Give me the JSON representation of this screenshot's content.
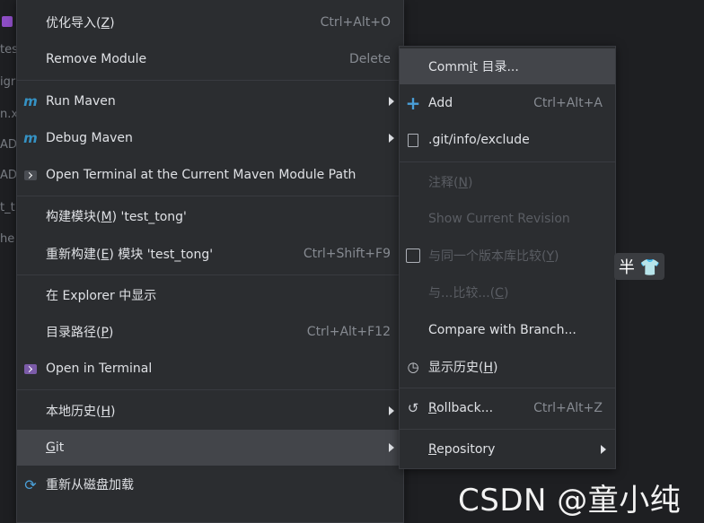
{
  "background": {
    "left_fragments": [
      "tes",
      "igr",
      "n.x",
      "ADI",
      "ADI",
      "t_t",
      "he"
    ]
  },
  "main_menu": {
    "items": [
      {
        "label_pre": "优化导入(",
        "mnemonic": "Z",
        "label_post": ")",
        "shortcut": "Ctrl+Alt+O"
      },
      {
        "label": "Remove Module",
        "shortcut": "Delete"
      },
      {
        "label": "Run Maven",
        "icon": "maven-run-icon"
      },
      {
        "label": "Debug Maven",
        "icon": "maven-debug-icon"
      },
      {
        "label": "Open Terminal at the Current Maven Module Path",
        "icon": "maven-terminal-icon"
      },
      {
        "label_pre": "构建模块(",
        "mnemonic": "M",
        "label_post": ") 'test_tong'"
      },
      {
        "label_pre": "重新构建(",
        "mnemonic": "E",
        "label_post": ") 模块 'test_tong'",
        "shortcut": "Ctrl+Shift+F9"
      },
      {
        "label": "在 Explorer 中显示"
      },
      {
        "label_pre": "目录路径(",
        "mnemonic": "P",
        "label_post": ")",
        "shortcut": "Ctrl+Alt+F12"
      },
      {
        "label": "Open in Terminal",
        "icon": "terminal-icon"
      },
      {
        "label_pre": "本地历史(",
        "mnemonic": "H",
        "label_post": ")"
      },
      {
        "label_pre": "",
        "mnemonic": "G",
        "label_post": "it"
      },
      {
        "label": "重新从磁盘加载",
        "icon": "reload-icon"
      }
    ]
  },
  "git_menu": {
    "items": [
      {
        "label_pre": "Comm",
        "mnemonic": "i",
        "label_post": "t 目录..."
      },
      {
        "label": "Add",
        "shortcut": "Ctrl+Alt+A",
        "icon": "plus-icon"
      },
      {
        "label": ".git/info/exclude",
        "icon": "git-file-icon"
      },
      {
        "label_pre": "注释(",
        "mnemonic": "N",
        "label_post": ")"
      },
      {
        "label": "Show Current Revision"
      },
      {
        "label_pre": "与同一个版本库比较(",
        "mnemonic": "Y",
        "label_post": ")",
        "icon": "compare-icon"
      },
      {
        "label_pre": "与...比较...(",
        "mnemonic": "C",
        "label_post": ")"
      },
      {
        "label": "Compare with Branch..."
      },
      {
        "label_pre": "显示历史(",
        "mnemonic": "H",
        "label_post": ")",
        "icon": "history-icon"
      },
      {
        "label_pre": "",
        "mnemonic": "R",
        "label_post": "ollback...",
        "shortcut": "Ctrl+Alt+Z",
        "icon": "rollback-icon"
      },
      {
        "label_pre": "",
        "mnemonic": "R",
        "label_post": "epository"
      }
    ]
  },
  "watermark": "CSDN @童小纯",
  "overlay_pill": "半 👕"
}
